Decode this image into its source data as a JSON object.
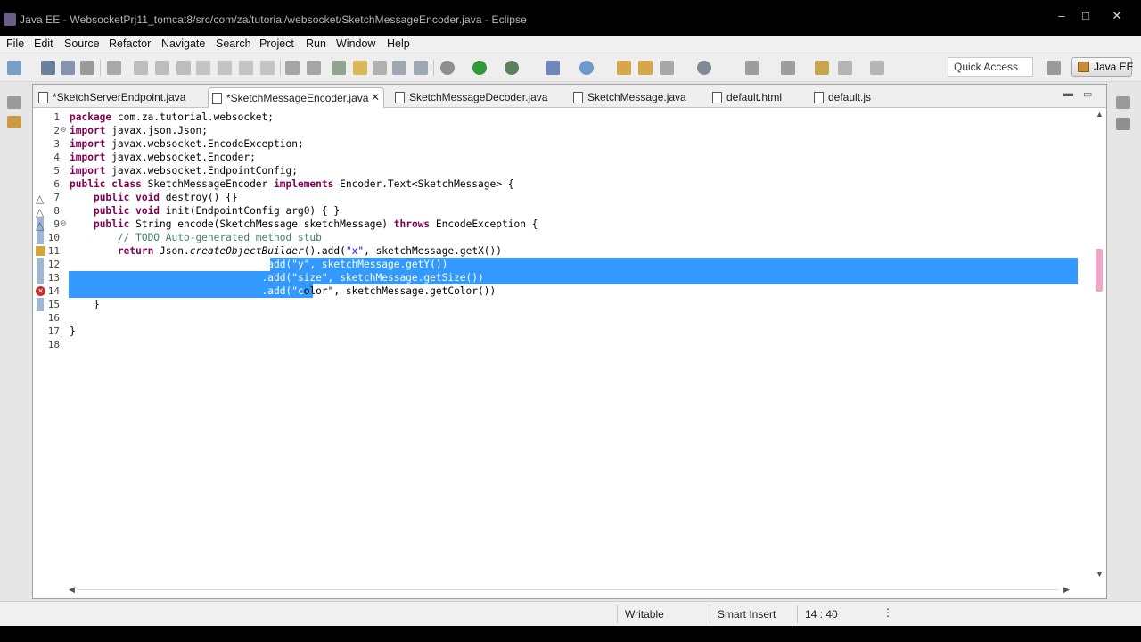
{
  "window": {
    "title": "Java EE - WebsocketPrj11_tomcat8/src/com/za/tutorial/websocket/SketchMessageEncoder.java - Eclipse",
    "controls": [
      "–",
      "□",
      "✕"
    ]
  },
  "menu": [
    "File",
    "Edit",
    "Source",
    "Refactor",
    "Navigate",
    "Search",
    "Project",
    "Run",
    "Window",
    "Help"
  ],
  "toolbar": {
    "quick_access": "Quick Access",
    "perspective": "Java EE"
  },
  "tabs": [
    {
      "label": "*SketchServerEndpoint.java",
      "active": false
    },
    {
      "label": "*SketchMessageEncoder.java",
      "active": true,
      "close": "✕"
    },
    {
      "label": "SketchMessageDecoder.java",
      "active": false
    },
    {
      "label": "SketchMessage.java",
      "active": false
    },
    {
      "label": "default.html",
      "active": false
    },
    {
      "label": "default.js",
      "active": false
    }
  ],
  "code": {
    "lines": [
      {
        "n": "1",
        "text": "package com.za.tutorial.websocket;"
      },
      {
        "n": "2",
        "text": "import javax.json.Json;"
      },
      {
        "n": "3",
        "text": "import javax.websocket.EncodeException;"
      },
      {
        "n": "4",
        "text": "import javax.websocket.Encoder;"
      },
      {
        "n": "5",
        "text": "import javax.websocket.EndpointConfig;"
      },
      {
        "n": "6",
        "text": "public class SketchMessageEncoder implements Encoder.Text<SketchMessage> {"
      },
      {
        "n": "7",
        "text": "    public void destroy() {}"
      },
      {
        "n": "8",
        "text": "    public void init(EndpointConfig arg0) { }"
      },
      {
        "n": "9",
        "text": "    public String encode(SketchMessage sketchMessage) throws EncodeException {"
      },
      {
        "n": "10",
        "text": "        // TODO Auto-generated method stub"
      },
      {
        "n": "11",
        "text": "        return Json.createObjectBuilder().add(\"x\", sketchMessage.getX())"
      },
      {
        "n": "12",
        "text": "                                .add(\"y\", sketchMessage.getY())"
      },
      {
        "n": "13",
        "text": "                                .add(\"size\", sketchMessage.getSize())"
      },
      {
        "n": "14",
        "text": "                                .add(\"color\", sketchMessage.getColor())"
      },
      {
        "n": "15",
        "text": "    }"
      },
      {
        "n": "16",
        "text": ""
      },
      {
        "n": "17",
        "text": "}"
      },
      {
        "n": "18",
        "text": ""
      }
    ]
  },
  "status": {
    "writable": "Writable",
    "insert_mode": "Smart Insert",
    "position": "14 : 40"
  },
  "colors": {
    "selection": "#3399ff",
    "keyword": "#7f0055",
    "string": "#2a00ff",
    "comment": "#3f7f5f"
  }
}
